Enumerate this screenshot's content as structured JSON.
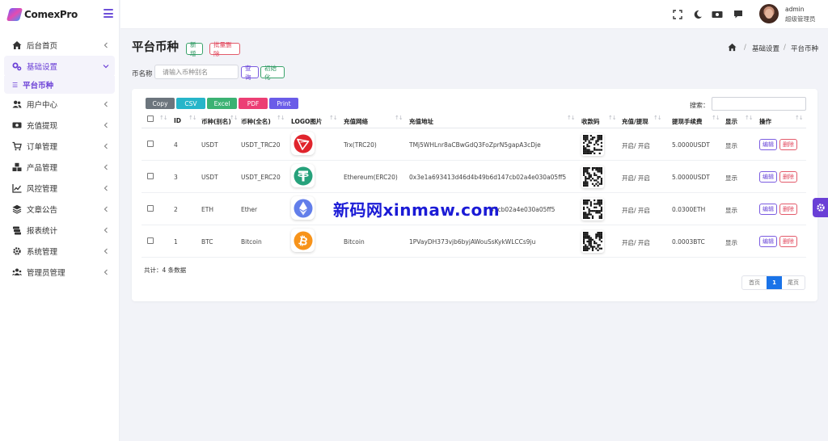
{
  "brand": {
    "name": "ComexPro"
  },
  "sidebar": {
    "items": [
      {
        "label": "后台首页",
        "icon": "home-icon"
      },
      {
        "label": "基础设置",
        "icon": "cogs-icon",
        "active": true
      },
      {
        "label": "用户中心",
        "icon": "users-icon"
      },
      {
        "label": "充值提现",
        "icon": "money-icon"
      },
      {
        "label": "订单管理",
        "icon": "cart-icon"
      },
      {
        "label": "产品管理",
        "icon": "cubes-icon"
      },
      {
        "label": "风控管理",
        "icon": "line-chart-icon"
      },
      {
        "label": "文章公告",
        "icon": "layers-icon"
      },
      {
        "label": "报表统计",
        "icon": "database-icon"
      },
      {
        "label": "系统管理",
        "icon": "gear-icon"
      },
      {
        "label": "管理员管理",
        "icon": "user-group-icon"
      }
    ],
    "sub_item": {
      "label": "平台币种"
    }
  },
  "topbar": {
    "user_name": "admin",
    "user_role": "超级管理员",
    "icons": [
      "fullscreen-icon",
      "moon-icon",
      "cash-icon",
      "comment-icon"
    ]
  },
  "page": {
    "title": "平台币种",
    "add_label": "新增",
    "batch_delete_label": "批量删除",
    "breadcrumb": [
      "基础设置",
      "/",
      "平台币种"
    ]
  },
  "filter": {
    "label": "币名称",
    "placeholder": "请输入币种别名",
    "query_label": "查询",
    "reset_label": "初始化"
  },
  "export": {
    "buttons": [
      {
        "label": "Copy",
        "color": "#6c757d"
      },
      {
        "label": "CSV",
        "color": "#26b5c9"
      },
      {
        "label": "Excel",
        "color": "#3bb273"
      },
      {
        "label": "PDF",
        "color": "#ec3e74"
      },
      {
        "label": "Print",
        "color": "#6a5ce8"
      }
    ]
  },
  "table": {
    "search_label": "搜索：",
    "columns": [
      "ID",
      "币种(别名)",
      "币种(全名)",
      "LOGO图片",
      "充值网络",
      "充值地址",
      "收款码",
      "充值/提现",
      "提现手续费",
      "显示",
      "操作"
    ],
    "edit_label": "编辑",
    "delete_label": "删除",
    "rows": [
      {
        "id": "4",
        "alias": "USDT",
        "full_name": "USDT_TRC20",
        "logo": "tron-logo-icon",
        "logo_color": "#e0242c",
        "network": "Trx(TRC20)",
        "address": "TMj5WHLnr8aCBwGdQ3FoZprN5gapA3cDje",
        "status": "开启/ 开启",
        "fee": "5.0000USDT",
        "display": "显示"
      },
      {
        "id": "3",
        "alias": "USDT",
        "full_name": "USDT_ERC20",
        "logo": "tether-logo-icon",
        "logo_color": "#26a17b",
        "network": "Ethereum(ERC20)",
        "address": "0x3e1a693413d46d4b49b6d147cb02a4e030a05ff5",
        "status": "开启/ 开启",
        "fee": "5.0000USDT",
        "display": "显示"
      },
      {
        "id": "2",
        "alias": "ETH",
        "full_name": "Ether",
        "logo": "ethereum-logo-icon",
        "logo_color": "#627eea",
        "network": "",
        "address": "47cb02a4e030a05ff5",
        "status": "开启/ 开启",
        "fee": "0.0300ETH",
        "display": "显示"
      },
      {
        "id": "1",
        "alias": "BTC",
        "full_name": "Bitcoin",
        "logo": "bitcoin-logo-icon",
        "logo_color": "#f7931a",
        "network": "Bitcoin",
        "address": "1PVayDH373vjb6byjAWouSsKykWLCCs9ju",
        "status": "开启/ 开启",
        "fee": "0.0003BTC",
        "display": "显示"
      }
    ],
    "total_text": "共计：4 条数据"
  },
  "pager": {
    "first": "首页",
    "current": "1",
    "last": "尾页"
  },
  "watermark": "新码网xinmaw.com"
}
